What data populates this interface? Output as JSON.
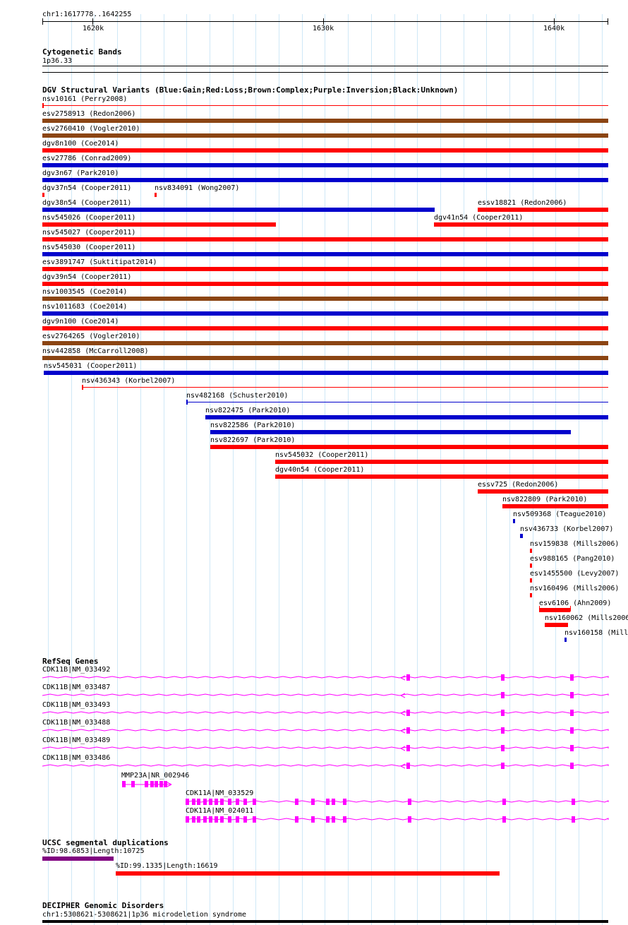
{
  "ruler": {
    "position": "chr1:1617778..1642255",
    "ticks": [
      "1620k",
      "1630k",
      "1640k"
    ]
  },
  "tracks": {
    "cytoband": {
      "title": "Cytogenetic Bands",
      "band": "1p36.33"
    },
    "dgv": {
      "title": "DGV Structural Variants (Blue:Gain;Red:Loss;Brown:Complex;Purple:Inversion;Black:Unknown)",
      "colors": {
        "gain": "#0000cc",
        "loss": "#ff0000",
        "complex": "#8b4513"
      },
      "features": [
        {
          "label": "nsv10161 (Perry2008)",
          "type": "loss"
        },
        {
          "label": "esv2758913 (Redon2006)",
          "type": "complex"
        },
        {
          "label": "esv2760410 (Vogler2010)",
          "type": "complex"
        },
        {
          "label": "dgv8n100 (Coe2014)",
          "type": "loss"
        },
        {
          "label": "esv27786 (Conrad2009)",
          "type": "gain"
        },
        {
          "label": "dgv3n67 (Park2010)",
          "type": "gain"
        },
        {
          "label": "dgv37n54 (Cooper2011)",
          "type": "loss"
        },
        {
          "label": "nsv834091 (Wong2007)",
          "type": "loss"
        },
        {
          "label": "dgv38n54 (Cooper2011)",
          "type": "gain"
        },
        {
          "label": "essv18821 (Redon2006)",
          "type": "loss"
        },
        {
          "label": "nsv545026 (Cooper2011)",
          "type": "loss"
        },
        {
          "label": "dgv41n54 (Cooper2011)",
          "type": "loss"
        },
        {
          "label": "nsv545027 (Cooper2011)",
          "type": "loss"
        },
        {
          "label": "nsv545030 (Cooper2011)",
          "type": "gain"
        },
        {
          "label": "esv3891747 (Suktitipat2014)",
          "type": "loss"
        },
        {
          "label": "dgv39n54 (Cooper2011)",
          "type": "loss"
        },
        {
          "label": "nsv1003545 (Coe2014)",
          "type": "complex"
        },
        {
          "label": "nsv1011683 (Coe2014)",
          "type": "gain"
        },
        {
          "label": "dgv9n100 (Coe2014)",
          "type": "loss"
        },
        {
          "label": "esv2764265 (Vogler2010)",
          "type": "complex"
        },
        {
          "label": "nsv442858 (McCarroll2008)",
          "type": "complex"
        },
        {
          "label": "nsv545031 (Cooper2011)",
          "type": "gain"
        },
        {
          "label": "nsv436343 (Korbel2007)",
          "type": "loss"
        },
        {
          "label": "nsv482168 (Schuster2010)",
          "type": "gain"
        },
        {
          "label": "nsv822475 (Park2010)",
          "type": "gain"
        },
        {
          "label": "nsv822586 (Park2010)",
          "type": "gain"
        },
        {
          "label": "nsv822697 (Park2010)",
          "type": "loss"
        },
        {
          "label": "nsv545032 (Cooper2011)",
          "type": "loss"
        },
        {
          "label": "dgv40n54 (Cooper2011)",
          "type": "loss"
        },
        {
          "label": "essv725 (Redon2006)",
          "type": "loss"
        },
        {
          "label": "nsv822809 (Park2010)",
          "type": "loss"
        },
        {
          "label": "nsv509368 (Teague2010)",
          "type": "gain"
        },
        {
          "label": "nsv436733 (Korbel2007)",
          "type": "gain"
        },
        {
          "label": "nsv159838 (Mills2006)",
          "type": "loss"
        },
        {
          "label": "esv988165 (Pang2010)",
          "type": "loss"
        },
        {
          "label": "esv1455500 (Levy2007)",
          "type": "loss"
        },
        {
          "label": "nsv160496 (Mills2006)",
          "type": "loss"
        },
        {
          "label": "esv6106 (Ahn2009)",
          "type": "loss"
        },
        {
          "label": "nsv160062 (Mills2006",
          "type": "loss"
        },
        {
          "label": "nsv160158 (Mill",
          "type": "gain"
        }
      ]
    },
    "refseq": {
      "title": "RefSeq Genes",
      "color": "#ff00ff",
      "genes": [
        "CDK11B|NM_033492",
        "CDK11B|NM_033487",
        "CDK11B|NM_033493",
        "CDK11B|NM_033488",
        "CDK11B|NM_033489",
        "CDK11B|NM_033486",
        "MMP23A|NR_002946",
        "CDK11A|NM_033529",
        "CDK11A|NM_024011"
      ]
    },
    "segdups": {
      "title": "UCSC segmental duplications",
      "items": [
        {
          "label": "%ID:98.6853|Length:10725",
          "color": "#800080"
        },
        {
          "label": "%ID:99.1335|Length:16619",
          "color": "#ff0000"
        }
      ]
    },
    "decipher": {
      "title": "DECIPHER Genomic Disorders",
      "item": "chr1:5308621-5308621|1p36 microdeletion syndrome"
    }
  }
}
